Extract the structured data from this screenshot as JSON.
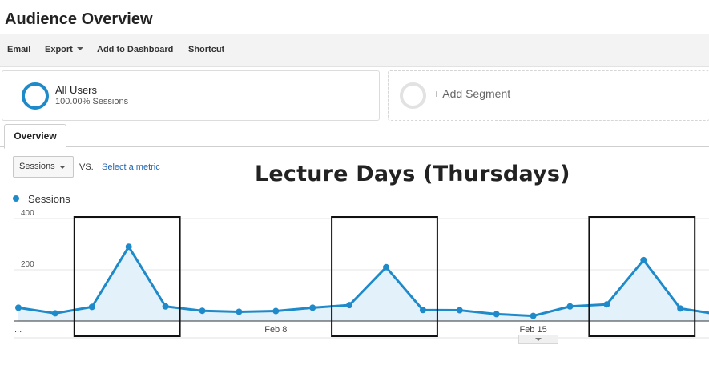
{
  "page": {
    "title": "Audience Overview"
  },
  "toolbar": {
    "email": "Email",
    "export": "Export",
    "add_to_dashboard": "Add to Dashboard",
    "shortcut": "Shortcut"
  },
  "segments": {
    "active": {
      "name": "All Users",
      "detail": "100.00% Sessions",
      "color": "#1f8ac9"
    },
    "add_label": "+ Add Segment"
  },
  "tabs": {
    "overview": "Overview"
  },
  "metric_picker": {
    "selected": "Sessions",
    "vs": "VS.",
    "select_metric": "Select a metric"
  },
  "annotation": "Lecture Days (Thursdays)",
  "chart_data": {
    "type": "area",
    "series": [
      {
        "name": "Sessions",
        "color": "#1f8ac9",
        "values": [
          52,
          30,
          55,
          290,
          57,
          40,
          36,
          39,
          52,
          62,
          210,
          43,
          42,
          27,
          20,
          57,
          65,
          238,
          49,
          27
        ]
      }
    ],
    "ylim": [
      0,
      400
    ],
    "y_ticks": [
      200,
      400
    ],
    "x_tick_labels": [
      {
        "index": 0,
        "label": "..."
      },
      {
        "index": 7,
        "label": "Feb 8"
      },
      {
        "index": 14,
        "label": "Feb 15"
      }
    ],
    "highlight_ranges": [
      [
        2,
        4
      ],
      [
        9,
        11
      ],
      [
        16,
        18
      ]
    ],
    "grid": true,
    "legend": "top-left"
  }
}
